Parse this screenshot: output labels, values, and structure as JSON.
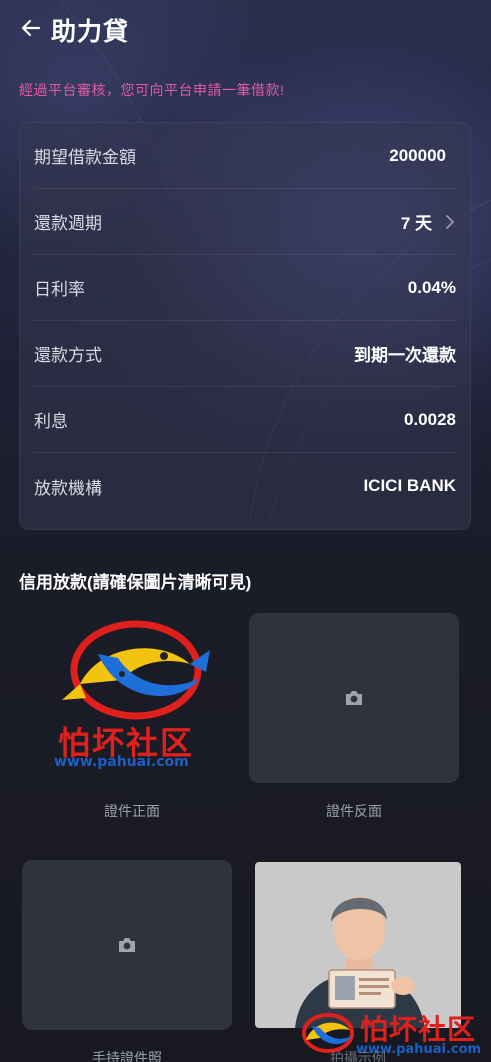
{
  "header": {
    "title": "助力貸",
    "back_icon": "arrow-left-icon"
  },
  "notice": "經過平台審核，您可向平台申請一筆借款!",
  "loan": {
    "rows": [
      {
        "label": "期望借款金額",
        "value": "200000"
      },
      {
        "label": "還款週期",
        "value": "7 天",
        "has_chevron": true
      },
      {
        "label": "日利率",
        "value": "0.04%"
      },
      {
        "label": "還款方式",
        "value": "到期一次還款"
      },
      {
        "label": "利息",
        "value": "0.0028"
      },
      {
        "label": "放款機構",
        "value": "ICICI BANK"
      }
    ]
  },
  "uploads": {
    "section_title": "信用放款(請確保圖片清晰可見)",
    "id_front": {
      "caption": "證件正面"
    },
    "id_back": {
      "caption": "證件反面",
      "icon": "camera-icon"
    },
    "hand_held": {
      "caption": "手持證件照",
      "icon": "camera-icon"
    },
    "sample": {
      "caption": "拍攝示例"
    }
  },
  "watermark": {
    "cn": "怕坏社区",
    "url": "www.pahuai.com"
  },
  "colors": {
    "notice": "#e35aa3",
    "background": "#1a1c28",
    "card": "#343750",
    "upload_box": "#30323d"
  }
}
